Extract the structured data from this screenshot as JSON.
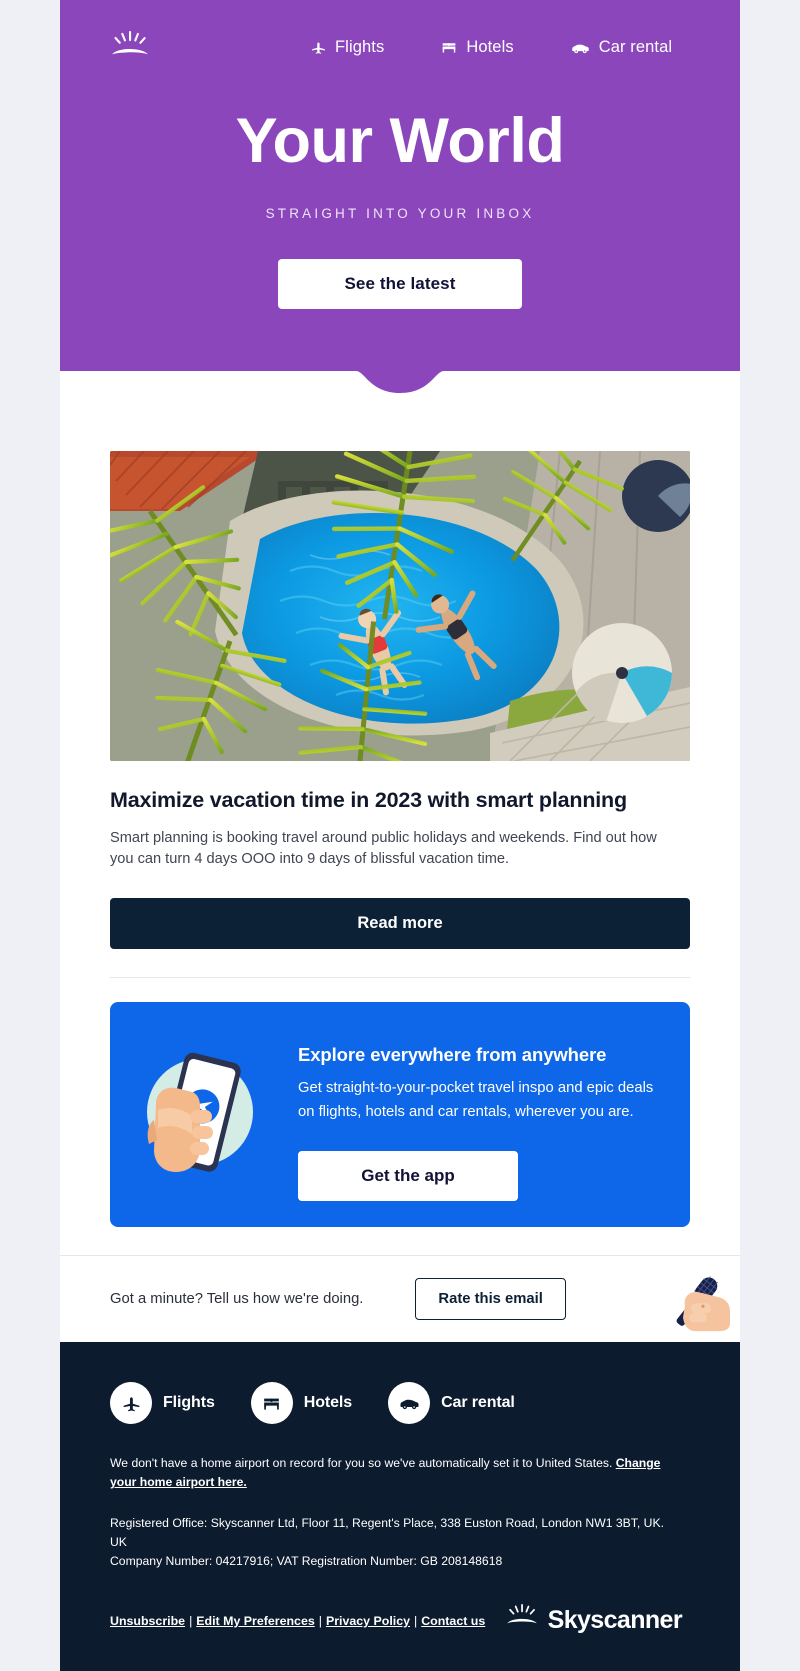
{
  "brand": {
    "name": "Skyscanner",
    "logo_icon": "sunburst-logo",
    "purple": "#8b46bc",
    "blue": "#0d67e8",
    "navy": "#0d2136",
    "footer_navy": "#0d1b2e",
    "page_bg": "#eef0f5"
  },
  "header": {
    "nav": [
      {
        "label": "Flights",
        "icon": "plane-icon"
      },
      {
        "label": "Hotels",
        "icon": "bed-icon"
      },
      {
        "label": "Car rental",
        "icon": "car-icon"
      }
    ],
    "title": "Your World",
    "subtitle": "STRAIGHT INTO YOUR INBOX",
    "cta_label": "See the latest"
  },
  "article": {
    "image_alt": "Aerial view of two people floating in a resort swimming pool framed by palm fronds",
    "title": "Maximize vacation time in 2023 with smart planning",
    "body": "Smart planning is booking travel around public holidays and weekends. Find out how you can turn 4 days OOO into 9 days of blissful vacation time.",
    "cta_label": "Read more"
  },
  "promo": {
    "illustration_alt": "Hand holding a smartphone showing a paper plane app icon",
    "title": "Explore everywhere from anywhere",
    "body": "Get straight-to-your-pocket travel inspo and epic deals on flights, hotels and car rentals, wherever you are.",
    "cta_label": "Get the app"
  },
  "rate": {
    "text": "Got a minute? Tell us how we're doing.",
    "cta_label": "Rate this email",
    "illustration_alt": "Hand holding a microphone"
  },
  "footer": {
    "nav": [
      {
        "label": "Flights",
        "icon": "plane-icon"
      },
      {
        "label": "Hotels",
        "icon": "bed-icon"
      },
      {
        "label": "Car rental",
        "icon": "car-icon"
      }
    ],
    "airport_note_text": "We don't have a home airport on record for you so we've automatically set it to United States. ",
    "airport_note_link": "Change your home airport here.",
    "legal_line1": "Registered Office: Skyscanner Ltd, Floor 11, Regent's Place, 338 Euston Road, London NW1 3BT, UK. UK",
    "legal_line2": "Company Number: 04217916; VAT Registration Number: GB 208148618",
    "links": [
      "Unsubscribe",
      "Edit My Preferences",
      "Privacy Policy",
      "Contact us"
    ],
    "link_separator": "|",
    "logo_word": "Skyscanner"
  }
}
